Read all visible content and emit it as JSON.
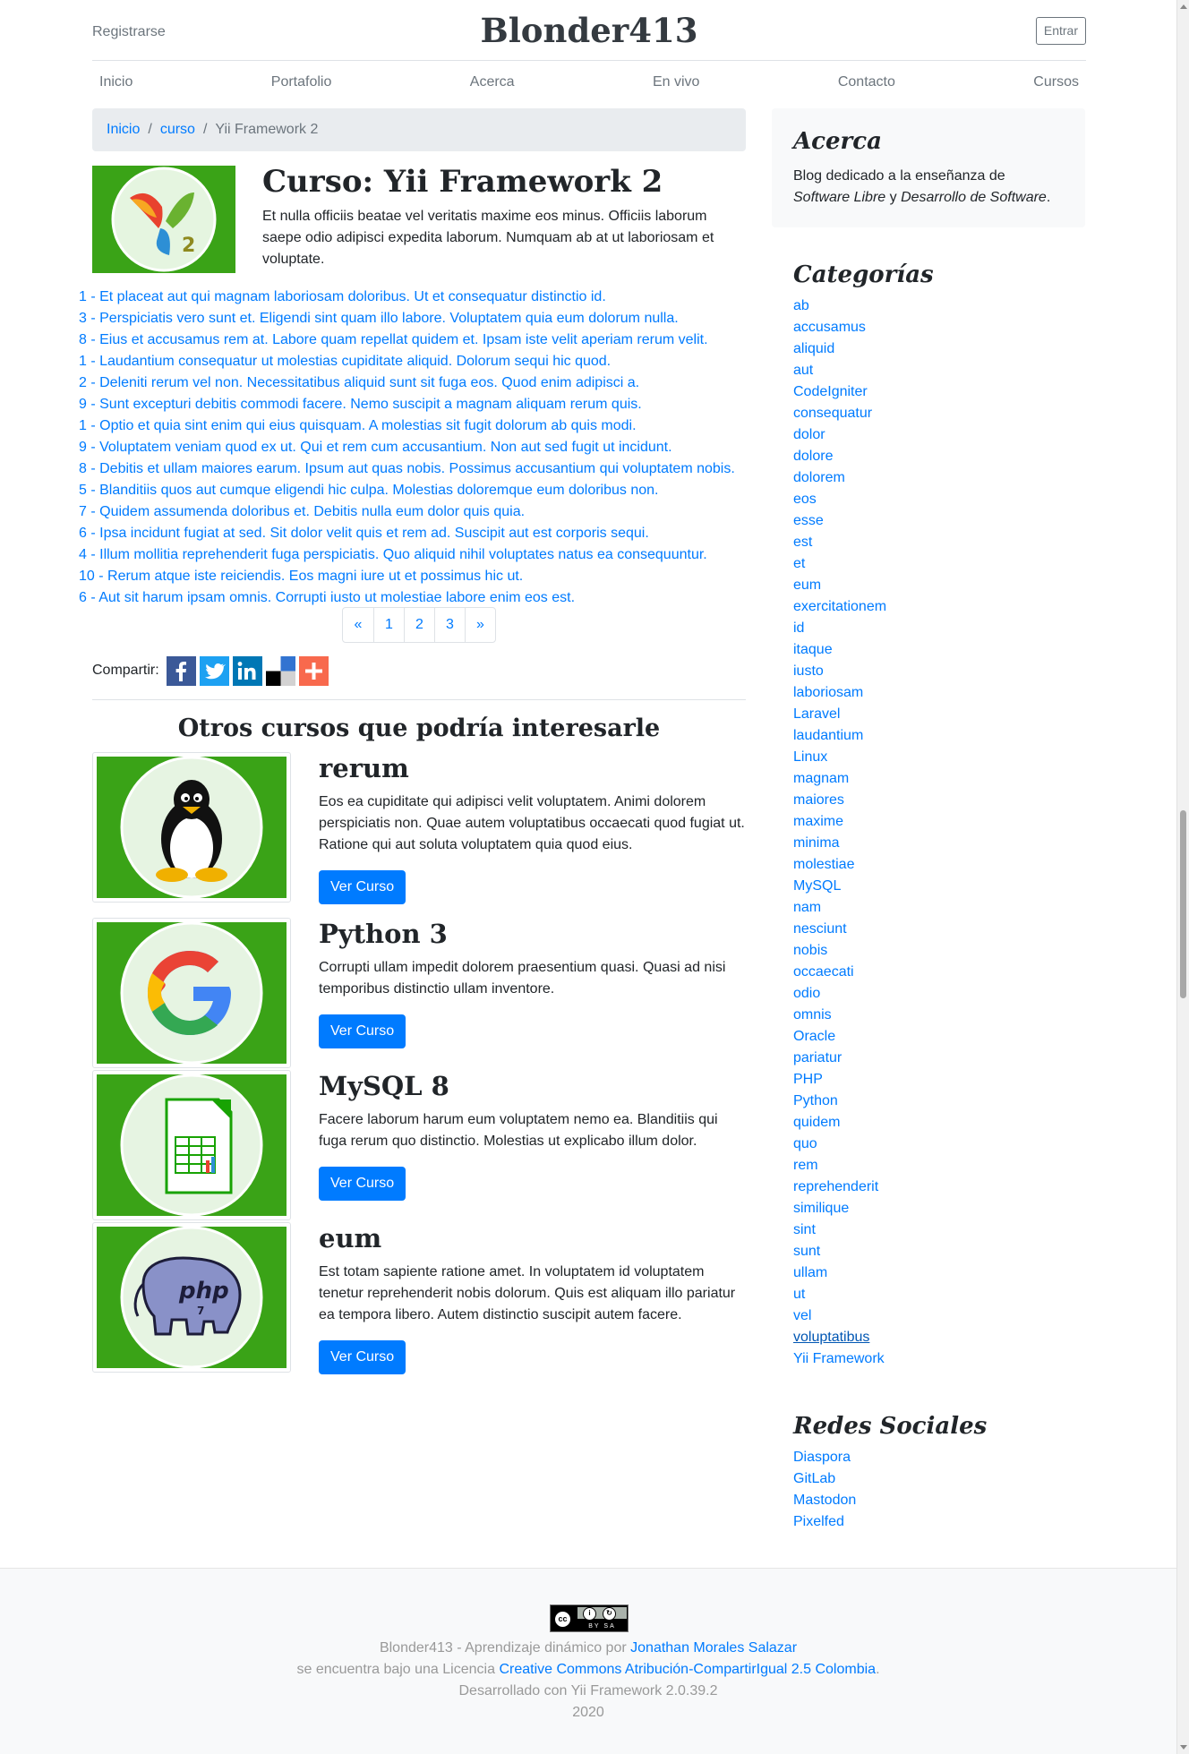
{
  "header": {
    "register": "Registrarse",
    "brand": "Blonder413",
    "login": "Entrar"
  },
  "nav": [
    "Inicio",
    "Portafolio",
    "Acerca",
    "En vivo",
    "Contacto",
    "Cursos"
  ],
  "breadcrumb": {
    "home": "Inicio",
    "section": "curso",
    "current": "Yii Framework 2"
  },
  "course": {
    "title": "Curso: Yii Framework 2",
    "description": "Et nulla officiis beatae vel veritatis maxime eos minus. Officiis laborum saepe odio adipisci expedita laborum. Numquam ab at ut laboriosam et voluptate."
  },
  "lessons": [
    "1 - Et placeat aut qui magnam laboriosam doloribus. Ut et consequatur distinctio id.",
    "3 - Perspiciatis vero sunt et. Eligendi sint quam illo labore. Voluptatem quia eum dolorum nulla.",
    "8 - Eius et accusamus rem at. Labore quam repellat quidem et. Ipsam iste velit aperiam rerum velit.",
    "1 - Laudantium consequatur ut molestias cupiditate aliquid. Dolorum sequi hic quod.",
    "2 - Deleniti rerum vel non. Necessitatibus aliquid sunt sit fuga eos. Quod enim adipisci a.",
    "9 - Sunt excepturi debitis commodi facere. Nemo suscipit a magnam aliquam rerum quis.",
    "1 - Optio et quia sint enim qui eius quisquam. A molestias sit fugit dolorum ab quis modi.",
    "9 - Voluptatem veniam quod ex ut. Qui et rem cum accusantium. Non aut sed fugit ut incidunt.",
    "8 - Debitis et ullam maiores earum. Ipsum aut quas nobis. Possimus accusantium qui voluptatem nobis.",
    "5 - Blanditiis quos aut cumque eligendi hic culpa. Molestias doloremque eum doloribus non.",
    "7 - Quidem assumenda doloribus et. Debitis nulla eum dolor quis quia.",
    "6 - Ipsa incidunt fugiat at sed. Sit dolor velit quis et rem ad. Suscipit aut est corporis sequi.",
    "4 - Illum mollitia reprehenderit fuga perspiciatis. Quo aliquid nihil voluptates natus ea consequuntur.",
    "10 - Rerum atque iste reiciendis. Eos magni iure ut et possimus hic ut.",
    "6 - Aut sit harum ipsam omnis. Corrupti iusto ut molestiae labore enim eos est."
  ],
  "pagination": {
    "prev": "«",
    "pages": [
      "1",
      "2",
      "3"
    ],
    "next": "»"
  },
  "share": {
    "label": "Compartir:",
    "icons": [
      "facebook-icon",
      "twitter-icon",
      "linkedin-icon",
      "delicious-icon",
      "addthis-icon"
    ]
  },
  "others": {
    "title": "Otros cursos que podría interesarle",
    "button_label": "Ver Curso",
    "items": [
      {
        "name": "rerum",
        "icon": "linux-tux-icon",
        "description": "Eos ea cupiditate qui adipisci velit voluptatem. Animi dolorem perspiciatis non. Quae autem voluptatibus occaecati quod fugiat ut. Ratione qui aut soluta voluptatem quia quod eius."
      },
      {
        "name": "Python 3",
        "icon": "google-g-icon",
        "description": "Corrupti ullam impedit dolorem praesentium quasi. Quasi ad nisi temporibus distinctio ullam inventore."
      },
      {
        "name": "MySQL 8",
        "icon": "spreadsheet-icon",
        "description": "Facere laborum harum eum voluptatem nemo ea. Blanditiis qui fuga rerum quo distinctio. Molestias ut explicabo illum dolor."
      },
      {
        "name": "eum",
        "icon": "php-elephant-icon",
        "description": "Est totam sapiente ratione amet. In voluptatem id voluptatem tenetur reprehenderit nobis dolorum. Quis est aliquam illo pariatur ea tempora libero. Autem distinctio suscipit autem facere."
      }
    ]
  },
  "about": {
    "title": "Acerca",
    "text_1": "Blog dedicado a la enseñanza de",
    "em_1": "Software Libre",
    "text_2": "y",
    "em_2": "Desarrollo de Software",
    "text_3": "."
  },
  "categories": {
    "title": "Categorías",
    "items": [
      "ab",
      "accusamus",
      "aliquid",
      "aut",
      "CodeIgniter",
      "consequatur",
      "dolor",
      "dolore",
      "dolorem",
      "eos",
      "esse",
      "est",
      "et",
      "eum",
      "exercitationem",
      "id",
      "itaque",
      "iusto",
      "laboriosam",
      "Laravel",
      "laudantium",
      "Linux",
      "magnam",
      "maiores",
      "maxime",
      "minima",
      "molestiae",
      "MySQL",
      "nam",
      "nesciunt",
      "nobis",
      "occaecati",
      "odio",
      "omnis",
      "Oracle",
      "pariatur",
      "PHP",
      "Python",
      "quidem",
      "quo",
      "rem",
      "reprehenderit",
      "similique",
      "sint",
      "sunt",
      "ullam",
      "ut",
      "vel",
      "voluptatibus",
      "Yii Framework"
    ],
    "hovered": "voluptatibus"
  },
  "socials": {
    "title": "Redes Sociales",
    "items": [
      "Diaspora",
      "GitLab",
      "Mastodon",
      "Pixelfed"
    ]
  },
  "footer": {
    "license_badge": "BY SA",
    "line1_prefix": "Blonder413 - Aprendizaje dinámico por",
    "author": "Jonathan Morales Salazar",
    "line2_prefix": "se encuentra bajo una Licencia",
    "license": "Creative Commons Atribución-CompartirIgual 2.5 Colombia",
    "line2_suffix": ".",
    "built_with": "Desarrollado con Yii Framework 2.0.39.2",
    "year": "2020"
  }
}
